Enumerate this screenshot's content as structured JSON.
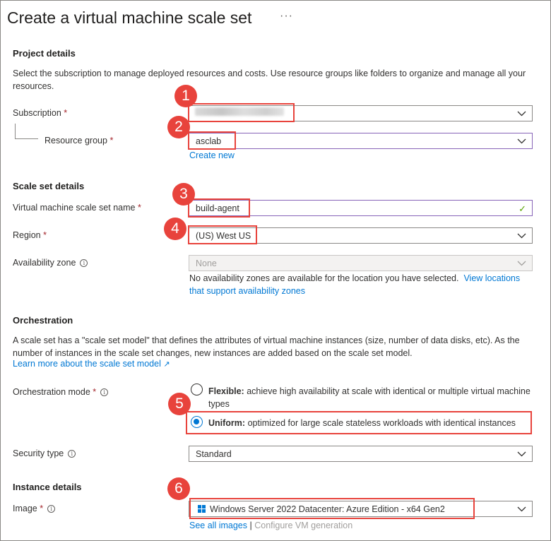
{
  "page": {
    "title": "Create a virtual machine scale set",
    "more": "···"
  },
  "project": {
    "heading": "Project details",
    "description": "Select the subscription to manage deployed resources and costs. Use resource groups like folders to organize and manage all your resources.",
    "subscription_label": "Subscription",
    "resource_group_label": "Resource group",
    "resource_group_value": "asclab",
    "create_new": "Create new"
  },
  "scaleset": {
    "heading": "Scale set details",
    "name_label": "Virtual machine scale set name",
    "name_value": "build-agent",
    "region_label": "Region",
    "region_value": "(US) West US",
    "az_label": "Availability zone",
    "az_value": "None",
    "az_note": "No availability zones are available for the location you have selected.",
    "az_link_1": "View locations",
    "az_link_2": "that support availability zones"
  },
  "orchestration": {
    "heading": "Orchestration",
    "description": "A scale set has a \"scale set model\" that defines the attributes of virtual machine instances (size, number of data disks, etc). As the number of instances in the scale set changes, new instances are added based on the scale set model.",
    "learn_more": "Learn more about the scale set model",
    "mode_label": "Orchestration mode",
    "flexible_title": "Flexible:",
    "flexible_desc": "achieve high availability at scale with identical or multiple virtual machine types",
    "uniform_title": "Uniform:",
    "uniform_desc": "optimized for large scale stateless workloads with identical instances",
    "security_label": "Security type",
    "security_value": "Standard"
  },
  "instance": {
    "heading": "Instance details",
    "image_label": "Image",
    "image_value": "Windows Server 2022 Datacenter: Azure Edition - x64 Gen2",
    "see_all": "See all images",
    "separator": "|",
    "configure": "Configure VM generation"
  },
  "required_marker": "*",
  "info_glyph": "i",
  "check_glyph": "✓",
  "external_glyph": "↗",
  "callouts": [
    "1",
    "2",
    "3",
    "4",
    "5",
    "6"
  ],
  "colors": {
    "accent": "#0078d4",
    "callout": "#e8433c",
    "required": "#a4262c",
    "valid": "#57a300"
  },
  "icons": [
    "chevron-down-icon",
    "info-icon",
    "checkmark-icon",
    "external-link-icon",
    "windows-logo-icon"
  ]
}
